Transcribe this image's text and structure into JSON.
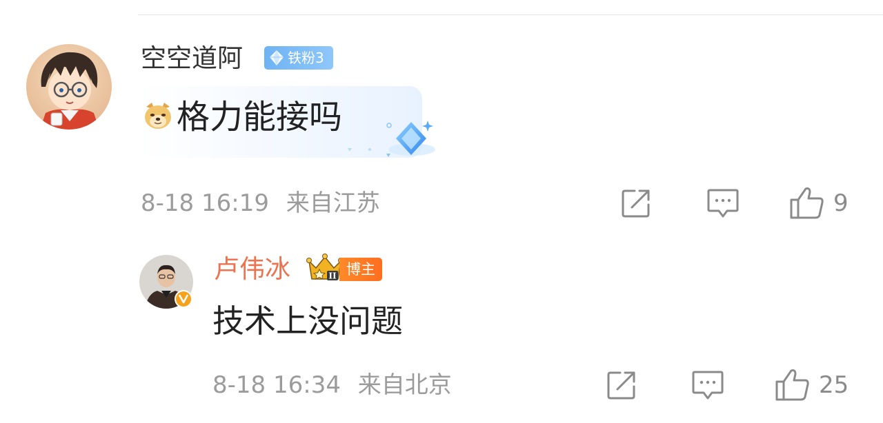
{
  "comment": {
    "username": "空空道阿",
    "fan_badge": "铁粉3",
    "avatar_icon": "anime-avatar-icon",
    "emoji": "doge-emoji-icon",
    "text": "格力能接吗",
    "time": "8-18 16:19",
    "location": "来自江苏",
    "like_count": "9"
  },
  "reply": {
    "username": "卢伟冰",
    "crown_level": "II",
    "badge": "博主",
    "avatar_icon": "person-avatar-icon",
    "verified_icon": "verified-v-icon",
    "text": "技术上没问题",
    "time": "8-18 16:34",
    "location": "来自北京",
    "like_count": "25"
  },
  "colors": {
    "username": "#333333",
    "reply_username": "#eb7350",
    "meta": "#9b9b9b",
    "fan_badge": "#7bbaf5",
    "blogger_badge": "#ff7a24"
  }
}
